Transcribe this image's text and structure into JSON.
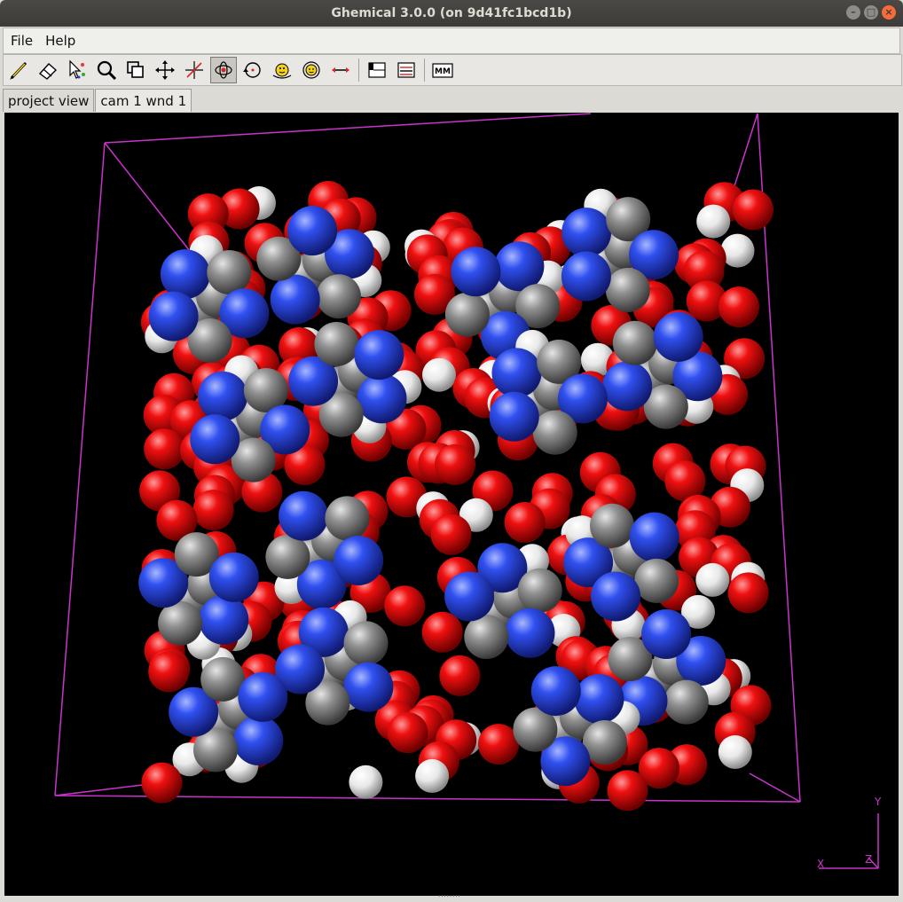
{
  "window": {
    "title": "Ghemical 3.0.0 (on 9d41fc1bcd1b)"
  },
  "menubar": {
    "items": [
      "File",
      "Help"
    ]
  },
  "toolbar": {
    "tools": [
      "draw",
      "erase",
      "select",
      "zoom",
      "clipping",
      "translate-xy",
      "translate-z",
      "orbit-xy",
      "orbit-z",
      "rotate-xy",
      "rotate-z",
      "measure",
      "element",
      "bond-type",
      "mm-setup"
    ],
    "active_tool": "orbit-xy",
    "mm_label": "MM"
  },
  "tabs": [
    {
      "label": "project view",
      "active": false
    },
    {
      "label": "cam 1 wnd 1",
      "active": true
    }
  ],
  "viewport": {
    "background": "#000000",
    "box_color": "#cc33cc",
    "atom_colors": {
      "oxygen": "#e60000",
      "nitrogen": "#3050f8",
      "carbon": "#8a8a8a",
      "hydrogen": "#f0f0f0"
    },
    "axis_labels": {
      "x": "X",
      "y": "Y",
      "z": "Z"
    }
  }
}
